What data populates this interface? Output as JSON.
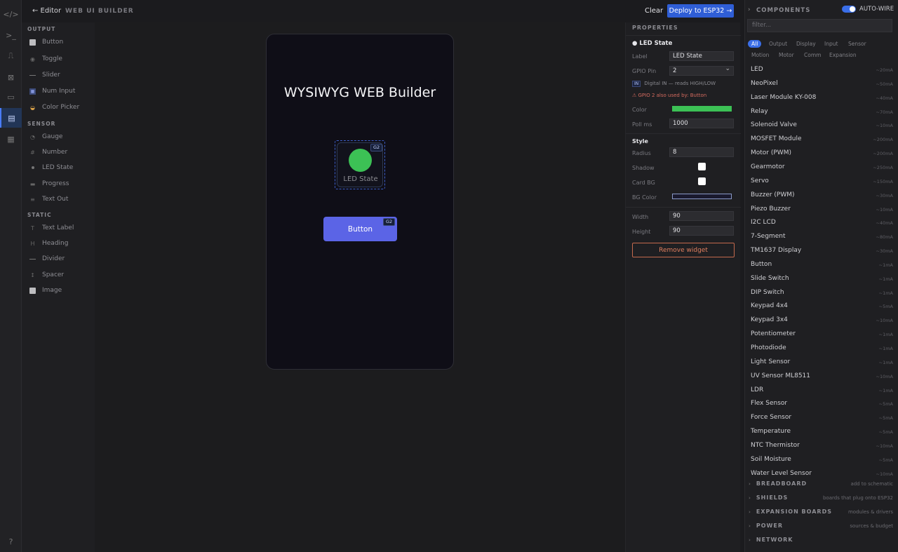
{
  "topbar": {
    "back_label": "← Editor",
    "title": "WEB UI BUILDER",
    "clear_label": "Clear",
    "deploy_label": "Deploy to ESP32 →"
  },
  "rail": [
    {
      "icon": "code-icon",
      "glyph": "</>"
    },
    {
      "icon": "terminal-icon",
      "glyph": ">_"
    },
    {
      "icon": "waveform-icon",
      "glyph": "⎍"
    },
    {
      "icon": "chip-icon",
      "glyph": "⊠"
    },
    {
      "icon": "folder-icon",
      "glyph": "▭"
    },
    {
      "icon": "web-builder-icon",
      "glyph": "▤"
    },
    {
      "icon": "apps-icon",
      "glyph": "▦"
    },
    {
      "icon": "help-icon",
      "glyph": "?"
    }
  ],
  "palette": {
    "output_label": "OUTPUT",
    "output": [
      "Button",
      "Toggle",
      "Slider",
      "Num Input",
      "Color Picker"
    ],
    "sensor_label": "SENSOR",
    "sensor": [
      "Gauge",
      "Number",
      "LED State",
      "Progress",
      "Text Out"
    ],
    "static_label": "STATIC",
    "static": [
      "Text Label",
      "Heading",
      "Divider",
      "Spacer",
      "Image"
    ]
  },
  "canvas": {
    "page_title": "WYSIWYG WEB Builder",
    "led": {
      "label": "LED State",
      "gpio": "G2",
      "color": "#3cc155"
    },
    "button": {
      "label": "Button",
      "gpio": "G2"
    }
  },
  "properties": {
    "title": "PROPERTIES",
    "selected": "● LED State",
    "label_label": "Label",
    "label_value": "LED State",
    "gpio_label": "GPIO Pin",
    "gpio_value": "2",
    "in_chip": "IN",
    "in_note": "Digital IN — reads HIGH/LOW",
    "warning": "⚠ GPIO 2 also used by: Button",
    "color_label": "Color",
    "color_value": "#3cc155",
    "poll_label": "Poll ms",
    "poll_value": "1000",
    "style_label": "Style",
    "radius_label": "Radius",
    "radius_value": "8",
    "shadow_label": "Shadow",
    "cardbg_label": "Card BG",
    "bgcolor_label": "BG Color",
    "bgcolor_value": "#1a1a2e",
    "width_label": "Width",
    "width_value": "90",
    "height_label": "Height",
    "height_value": "90",
    "remove_label": "Remove widget"
  },
  "components": {
    "title": "COMPONENTS",
    "autowire_label": "AUTO-WIRE",
    "filter_placeholder": "filter...",
    "categories": [
      "All",
      "Output",
      "Display",
      "Input",
      "Sensor",
      "Motion",
      "Motor",
      "Comm",
      "Expansion"
    ],
    "items": [
      {
        "name": "LED",
        "current": "~20mA"
      },
      {
        "name": "NeoPixel",
        "current": "~50mA"
      },
      {
        "name": "Laser Module KY-008",
        "current": "~40mA"
      },
      {
        "name": "Relay",
        "current": "~70mA"
      },
      {
        "name": "Solenoid Valve",
        "current": "~10mA"
      },
      {
        "name": "MOSFET Module",
        "current": "~200mA"
      },
      {
        "name": "Motor (PWM)",
        "current": "~200mA"
      },
      {
        "name": "Gearmotor",
        "current": "~250mA"
      },
      {
        "name": "Servo",
        "current": "~150mA"
      },
      {
        "name": "Buzzer (PWM)",
        "current": "~30mA"
      },
      {
        "name": "Piezo Buzzer",
        "current": "~10mA"
      },
      {
        "name": "I2C LCD",
        "current": "~40mA"
      },
      {
        "name": "7-Segment",
        "current": "~80mA"
      },
      {
        "name": "TM1637 Display",
        "current": "~30mA"
      },
      {
        "name": "Button",
        "current": "~1mA"
      },
      {
        "name": "Slide Switch",
        "current": "~1mA"
      },
      {
        "name": "DIP Switch",
        "current": "~1mA"
      },
      {
        "name": "Keypad 4x4",
        "current": "~5mA"
      },
      {
        "name": "Keypad 3x4",
        "current": "~10mA"
      },
      {
        "name": "Potentiometer",
        "current": "~1mA"
      },
      {
        "name": "Photodiode",
        "current": "~1mA"
      },
      {
        "name": "Light Sensor",
        "current": "~1mA"
      },
      {
        "name": "UV Sensor ML8511",
        "current": "~10mA"
      },
      {
        "name": "LDR",
        "current": "~1mA"
      },
      {
        "name": "Flex Sensor",
        "current": "~5mA"
      },
      {
        "name": "Force Sensor",
        "current": "~5mA"
      },
      {
        "name": "Temperature",
        "current": "~5mA"
      },
      {
        "name": "NTC Thermistor",
        "current": "~10mA"
      },
      {
        "name": "Soil Moisture",
        "current": "~5mA"
      },
      {
        "name": "Water Level Sensor",
        "current": "~10mA"
      }
    ],
    "accordions": [
      {
        "name": "BREADBOARD",
        "desc": "add to schematic"
      },
      {
        "name": "SHIELDS",
        "desc": "boards that plug onto ESP32"
      },
      {
        "name": "EXPANSION BOARDS",
        "desc": "modules & drivers"
      },
      {
        "name": "POWER",
        "desc": "sources & budget"
      },
      {
        "name": "NETWORK",
        "desc": ""
      }
    ]
  }
}
